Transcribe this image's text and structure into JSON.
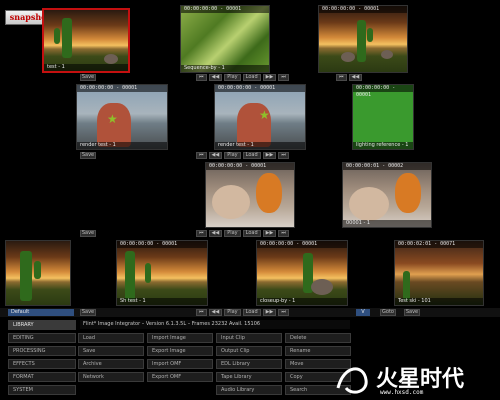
{
  "toolbar": {
    "snapshot_label": "snapshot"
  },
  "thumbnails": [
    {
      "timecode": "",
      "caption": "test - 1"
    },
    {
      "timecode": "00:00:00:00 - 00001",
      "caption": "Sequence-by - 1"
    },
    {
      "timecode": "00:00:00:00 - 00001",
      "caption": ""
    },
    {
      "timecode": "00:00:00:00 - 00001",
      "caption": "render test - 1"
    },
    {
      "timecode": "00:00:00:00 - 00001",
      "caption": "render test - 1"
    },
    {
      "timecode": "00:00:00:00 - 00001",
      "caption": "lighting reference - 1"
    },
    {
      "timecode": "00:00:00:00 - 00001",
      "caption": ""
    },
    {
      "timecode": "00:00:00:01 - 00002",
      "caption": "00001 - 1"
    },
    {
      "timecode": "",
      "caption": ""
    },
    {
      "timecode": "00:00:00:00 - 00001",
      "caption": "Sh test - 1"
    },
    {
      "timecode": "00:00:00:00 - 00001",
      "caption": "closeup-by - 1"
    },
    {
      "timecode": "00:00:02:01 - 00071",
      "caption": "Test ski - 101"
    }
  ],
  "controls": {
    "save": "Save",
    "prev": "⏮",
    "back": "◀◀",
    "play": "Play",
    "load": "Load",
    "fwd": "▶▶",
    "next": "⏭",
    "goto": "Goto"
  },
  "bottom": {
    "default_field": "Default",
    "v_button": "V"
  },
  "status_line": "Flint* Image Integrator – Version 6.1.3.5L – Frames 23232 Avail. 15106",
  "categories": [
    {
      "label": "LIBRARY"
    },
    {
      "label": "EDITING"
    },
    {
      "label": "PROCESSING"
    },
    {
      "label": "EFFECTS"
    },
    {
      "label": "FORMAT"
    },
    {
      "label": "SYSTEM"
    }
  ],
  "actions": {
    "col1": [
      "Load",
      "Save",
      "Archive",
      "Network"
    ],
    "col2": [
      "Import Image",
      "Export Image",
      "Import OMF",
      "Export OMF"
    ],
    "col3": [
      "Input Clip",
      "Output Clip",
      "EDL Library",
      "Tape Library",
      "Audio Library"
    ],
    "col4": [
      "Delete",
      "Rename",
      "Move",
      "Copy",
      "Search"
    ]
  },
  "watermark": {
    "brand": "火星时代",
    "url": "www.hxsd.com"
  },
  "colors": {
    "selection": "#c41010",
    "field_blue": "#2f4f7f",
    "snapshot_text": "#c00000"
  }
}
